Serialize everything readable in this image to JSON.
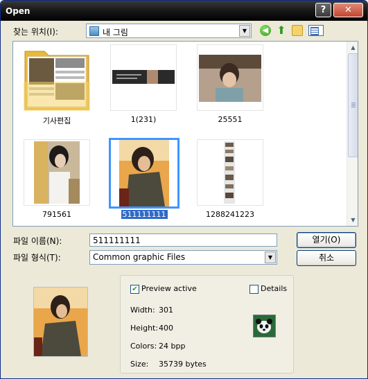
{
  "window": {
    "title": "Open",
    "help_glyph": "?",
    "close_glyph": "✕"
  },
  "toolbar": {
    "lookin_label": "찾는 위치(I):",
    "lookin_value": "내 그림",
    "icons": [
      "back-icon",
      "up-folder-icon",
      "new-folder-icon",
      "view-menu-icon"
    ]
  },
  "files": [
    {
      "name": "기사편집",
      "kind": "folder",
      "selected": false
    },
    {
      "name": "1(231)",
      "kind": "image",
      "selected": false
    },
    {
      "name": "25551",
      "kind": "image",
      "selected": false
    },
    {
      "name": "791561",
      "kind": "image",
      "selected": false
    },
    {
      "name": "511111111",
      "kind": "image",
      "selected": true
    },
    {
      "name": "1288241223",
      "kind": "image",
      "selected": false
    }
  ],
  "form": {
    "filename_label": "파일 이름(N):",
    "filename_value": "511111111",
    "filetype_label": "파일 형식(T):",
    "filetype_value": "Common graphic Files",
    "open_button": "열기(O)",
    "cancel_button": "취소"
  },
  "preview": {
    "preview_active_label": "Preview active",
    "preview_active_checked": true,
    "details_label": "Details",
    "details_checked": false,
    "width_label": "Width:",
    "width_value": "301",
    "height_label": "Height:",
    "height_value": "400",
    "colors_label": "Colors:",
    "colors_value": "24 bpp",
    "size_label": "Size:",
    "size_value": "35739 bytes"
  }
}
